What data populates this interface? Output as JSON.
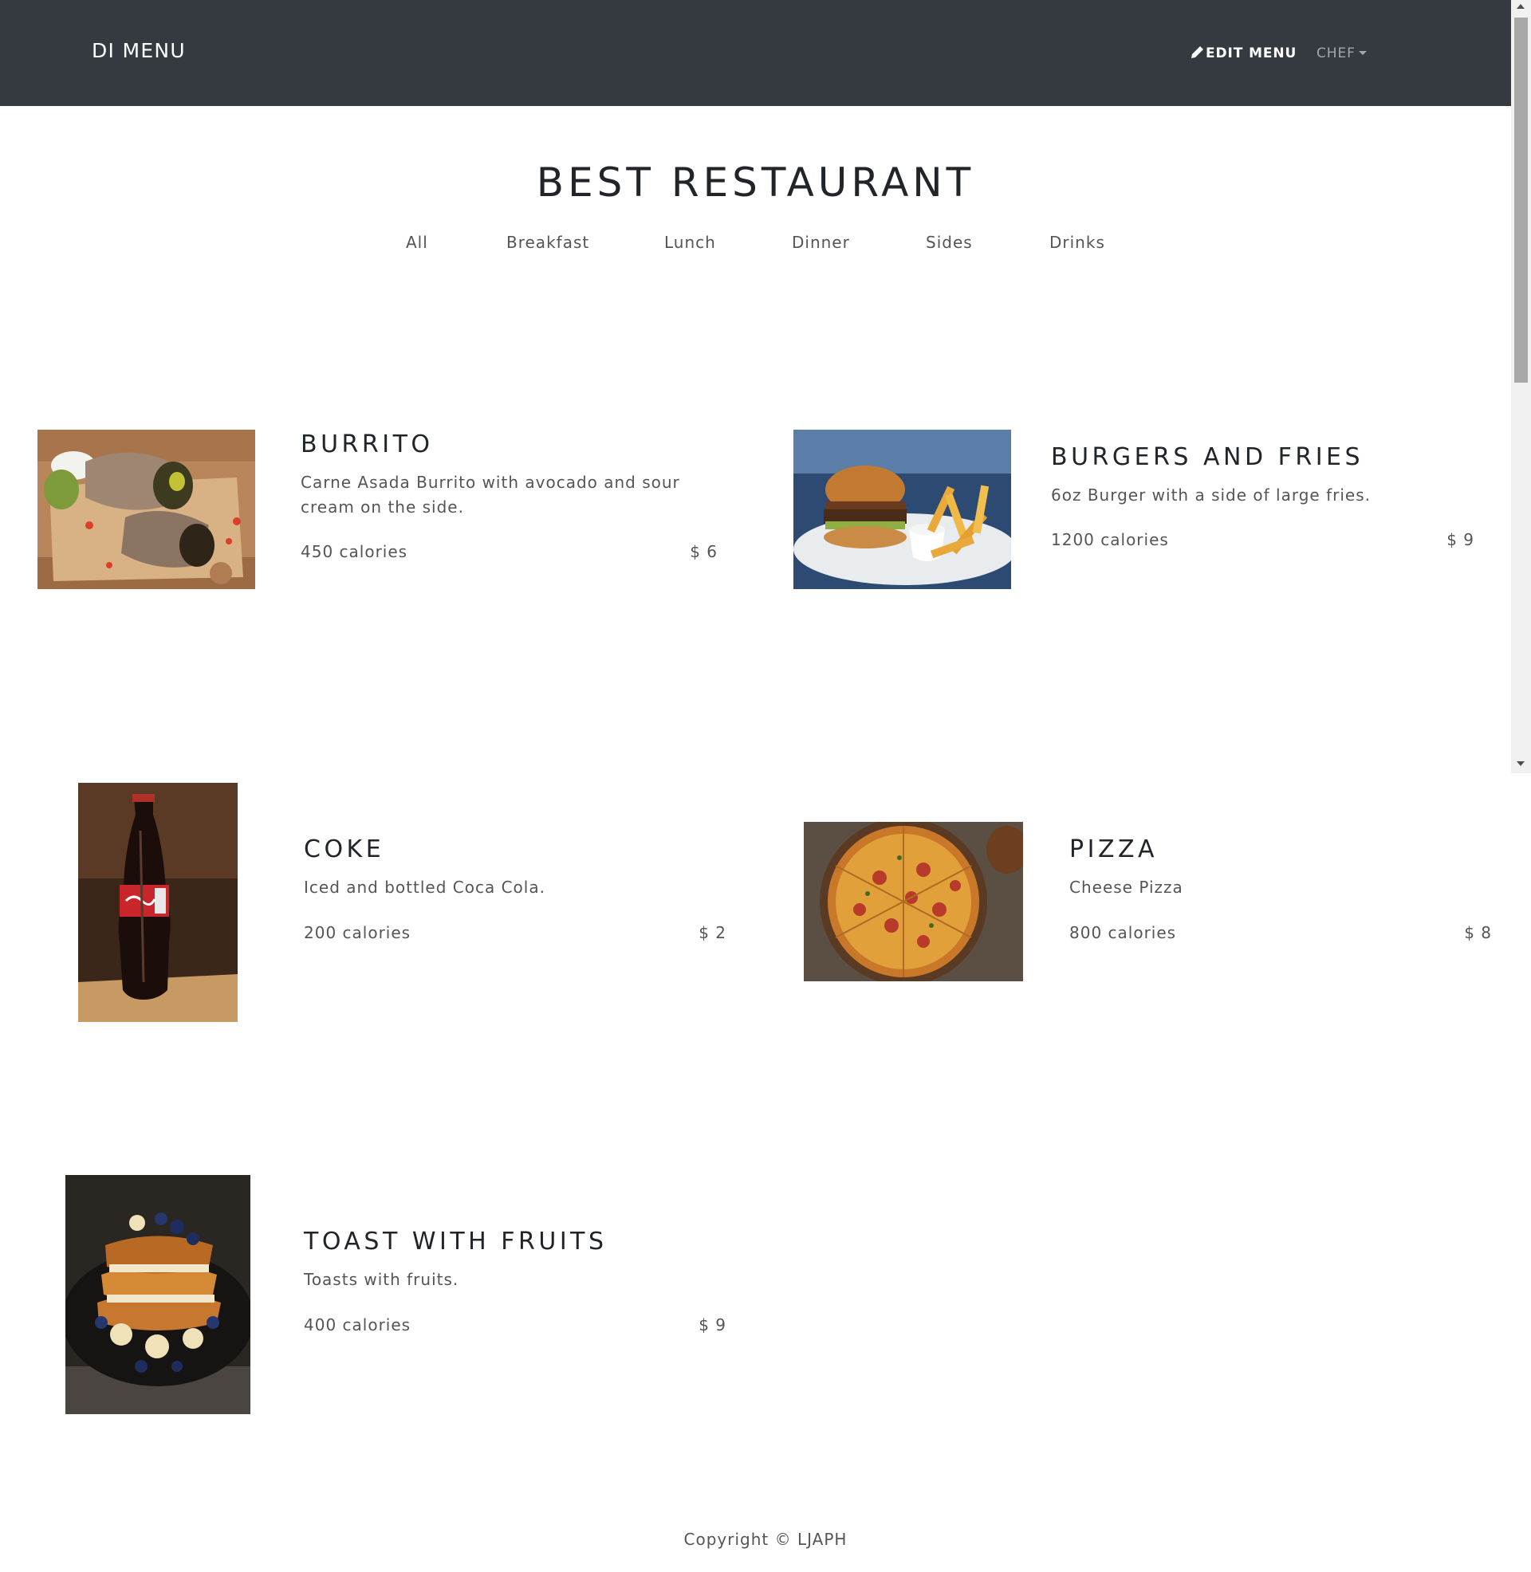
{
  "navbar": {
    "brand": "DI MENU",
    "edit_menu": "EDIT MENU",
    "user_menu": "CHEF",
    "edit_icon": "pen-icon",
    "dropdown_icon": "caret-down-icon"
  },
  "page": {
    "title": "BEST RESTAURANT"
  },
  "filters": [
    {
      "label": "All"
    },
    {
      "label": "Breakfast"
    },
    {
      "label": "Lunch"
    },
    {
      "label": "Dinner"
    },
    {
      "label": "Sides"
    },
    {
      "label": "Drinks"
    }
  ],
  "items": [
    {
      "title": "BURRITO",
      "description": "Carne Asada Burrito with avocado and sour cream on the side.",
      "calories": "450 calories",
      "price": "$ 6"
    },
    {
      "title": "BURGERS AND FRIES",
      "description": "6oz Burger with a side of large fries.",
      "calories": "1200 calories",
      "price": "$ 9"
    },
    {
      "title": "COKE",
      "description": "Iced and bottled Coca Cola.",
      "calories": "200 calories",
      "price": "$ 2"
    },
    {
      "title": "PIZZA",
      "description": "Cheese Pizza",
      "calories": "800 calories",
      "price": "$ 8"
    },
    {
      "title": "TOAST WITH FRUITS",
      "description": "Toasts with fruits.",
      "calories": "400 calories",
      "price": "$ 9"
    }
  ],
  "footer": {
    "copyright": "Copyright © LJAPH"
  },
  "colors": {
    "navbar_bg": "#343a40",
    "text_dark": "#212529",
    "text_muted": "#555555"
  }
}
